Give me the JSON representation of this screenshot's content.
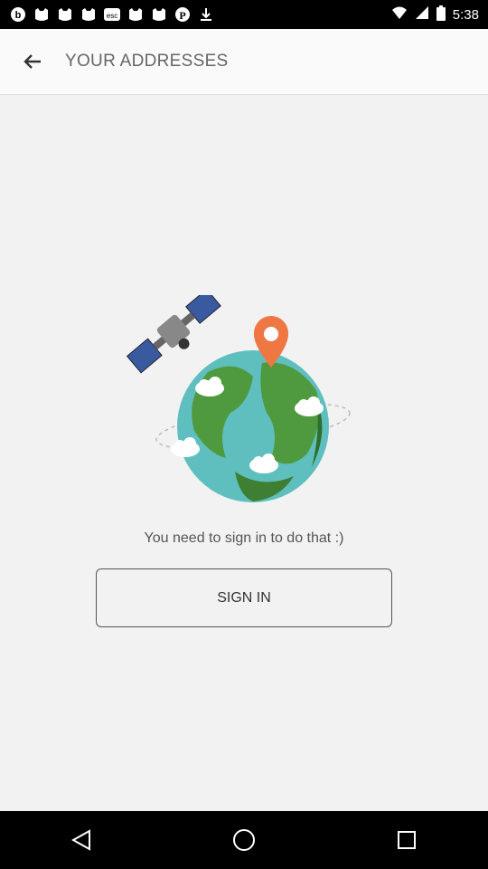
{
  "status_bar": {
    "time": "5:38",
    "icons": [
      "b-icon",
      "cat-icon",
      "cat-icon",
      "cat-icon",
      "esc-icon",
      "cat-icon",
      "cat-icon",
      "pinterest-icon",
      "download-icon",
      "wifi-icon",
      "signal-icon",
      "battery-icon"
    ]
  },
  "header": {
    "title": "YOUR ADDRESSES"
  },
  "main": {
    "message": "You need to sign in to do that :)",
    "sign_in_label": "SIGN IN"
  },
  "colors": {
    "ocean": "#5fbfbf",
    "land": "#4f9a3e",
    "pin": "#ee7744"
  }
}
